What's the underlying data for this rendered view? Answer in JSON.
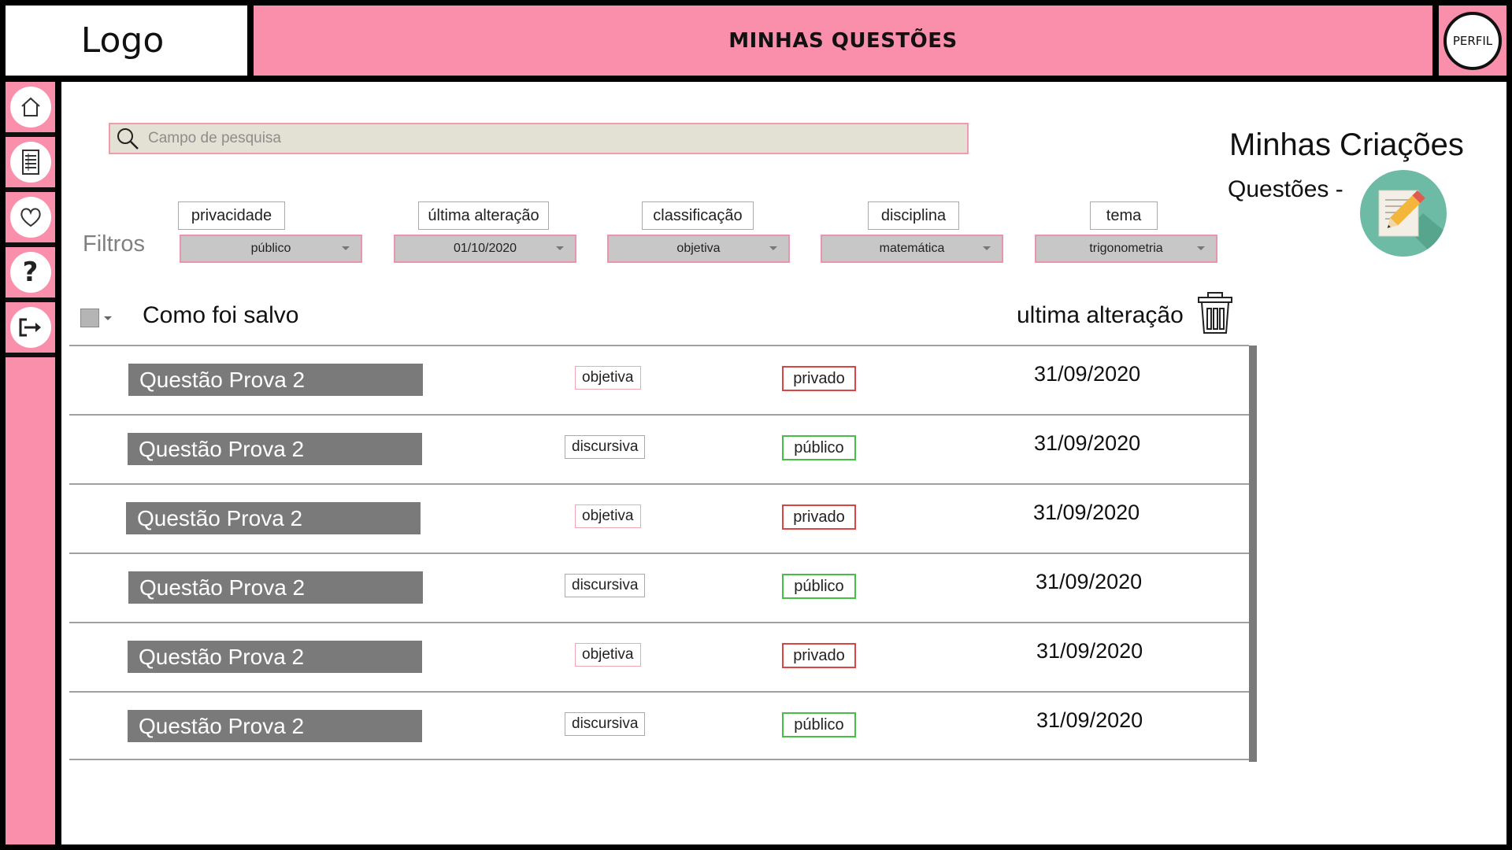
{
  "header": {
    "logo_text": "Logo",
    "page_title": "MINHAS QUESTÕES",
    "profile_label": "PERFIL"
  },
  "sidebar": {
    "items": [
      {
        "name": "home-icon"
      },
      {
        "name": "document-icon"
      },
      {
        "name": "heart-icon"
      },
      {
        "name": "help-icon"
      },
      {
        "name": "logout-icon"
      }
    ]
  },
  "search": {
    "placeholder": "Campo de pesquisa"
  },
  "creations": {
    "title": "Minhas Criações",
    "subtitle": "Questões -"
  },
  "filters": {
    "label": "Filtros",
    "items": [
      {
        "tag": "privacidade",
        "value": "público"
      },
      {
        "tag": "última alteração",
        "value": "01/10/2020"
      },
      {
        "tag": "classificação",
        "value": "objetiva"
      },
      {
        "tag": "disciplina",
        "value": "matemática"
      },
      {
        "tag": "tema",
        "value": "trigonometria"
      }
    ]
  },
  "list": {
    "header_title": "Como foi salvo",
    "header_last_change": "ultima alteração",
    "rows": [
      {
        "name": "Questão Prova 2",
        "type": "objetiva",
        "privacy": "privado",
        "date": "31/09/2020"
      },
      {
        "name": "Questão Prova 2",
        "type": "discursiva",
        "privacy": "público",
        "date": "31/09/2020"
      },
      {
        "name": "Questão Prova 2",
        "type": "objetiva",
        "privacy": "privado",
        "date": "31/09/2020"
      },
      {
        "name": "Questão Prova 2",
        "type": "discursiva",
        "privacy": "público",
        "date": "31/09/2020"
      },
      {
        "name": "Questão Prova 2",
        "type": "objetiva",
        "privacy": "privado",
        "date": "31/09/2020"
      },
      {
        "name": "Questão Prova 2",
        "type": "discursiva",
        "privacy": "público",
        "date": "31/09/2020"
      }
    ]
  },
  "colors": {
    "accent_pink": "#f98fab",
    "privado_border": "#d94444",
    "publico_border": "#44c044",
    "question_box": "#7a7a7a"
  }
}
